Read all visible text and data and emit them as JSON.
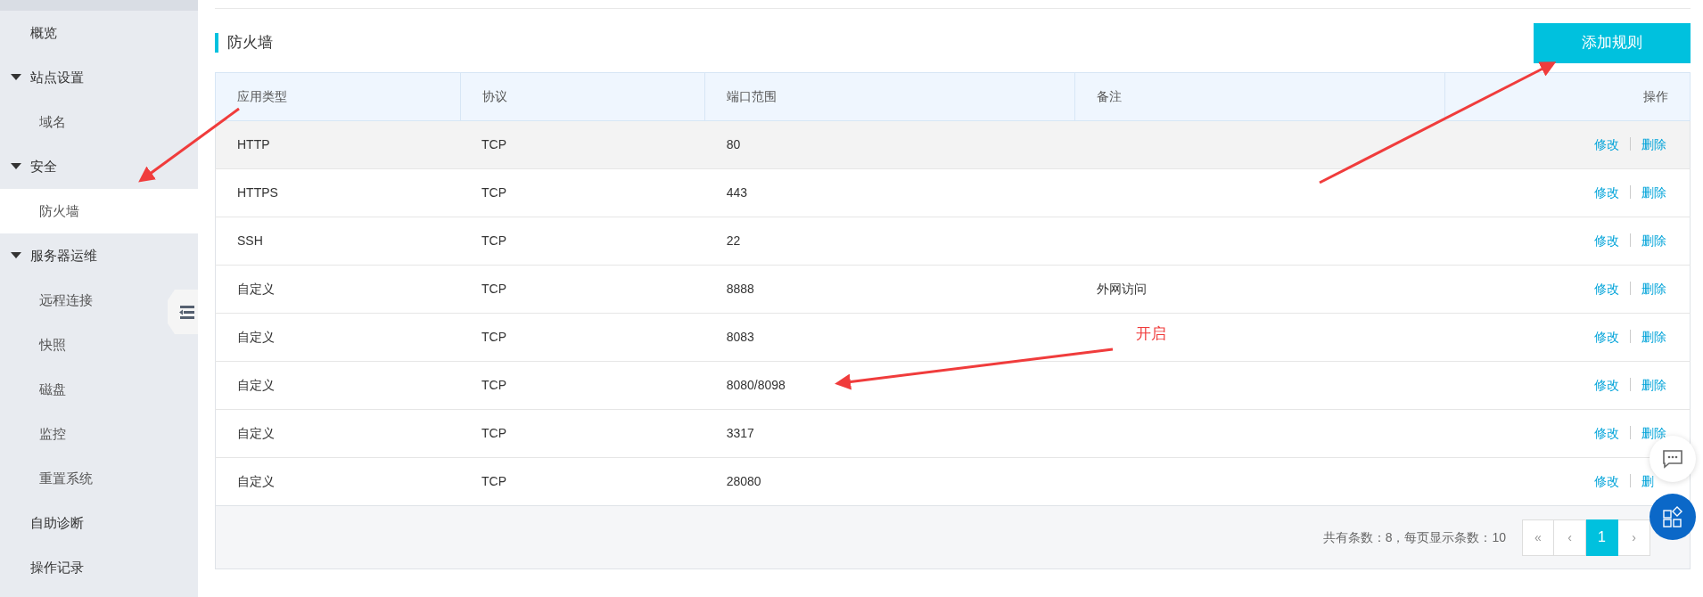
{
  "sidebar": {
    "items": [
      {
        "label": "概览",
        "selected": false
      },
      {
        "label": "站点设置",
        "selected": false,
        "expanded": true,
        "children": [
          {
            "label": "域名",
            "selected": false
          }
        ]
      },
      {
        "label": "安全",
        "selected": false,
        "expanded": true,
        "children": [
          {
            "label": "防火墙",
            "selected": true
          }
        ]
      },
      {
        "label": "服务器运维",
        "selected": false,
        "expanded": true,
        "children": [
          {
            "label": "远程连接",
            "selected": false
          },
          {
            "label": "快照",
            "selected": false
          },
          {
            "label": "磁盘",
            "selected": false
          },
          {
            "label": "监控",
            "selected": false
          },
          {
            "label": "重置系统",
            "selected": false
          }
        ]
      },
      {
        "label": "自助诊断",
        "selected": false
      },
      {
        "label": "操作记录",
        "selected": false
      }
    ]
  },
  "section": {
    "title": "防火墙",
    "add_button": "添加规则"
  },
  "table": {
    "columns": [
      "应用类型",
      "协议",
      "端口范围",
      "备注",
      "操作"
    ],
    "rows": [
      {
        "cells": [
          "HTTP",
          "TCP",
          "80",
          ""
        ],
        "actions": [
          "修改",
          "删除"
        ],
        "hovered": true
      },
      {
        "cells": [
          "HTTPS",
          "TCP",
          "443",
          ""
        ],
        "actions": [
          "修改",
          "删除"
        ],
        "hovered": false
      },
      {
        "cells": [
          "SSH",
          "TCP",
          "22",
          ""
        ],
        "actions": [
          "修改",
          "删除"
        ],
        "hovered": false
      },
      {
        "cells": [
          "自定义",
          "TCP",
          "8888",
          "外网访问"
        ],
        "actions": [
          "修改",
          "删除"
        ],
        "hovered": false
      },
      {
        "cells": [
          "自定义",
          "TCP",
          "8083",
          ""
        ],
        "actions": [
          "修改",
          "删除"
        ],
        "hovered": false
      },
      {
        "cells": [
          "自定义",
          "TCP",
          "8080/8098",
          ""
        ],
        "actions": [
          "修改",
          "删除"
        ],
        "hovered": false
      },
      {
        "cells": [
          "自定义",
          "TCP",
          "3317",
          ""
        ],
        "actions": [
          "修改",
          "删除"
        ],
        "hovered": false
      },
      {
        "cells": [
          "自定义",
          "TCP",
          "28080",
          ""
        ],
        "actions": [
          "修改",
          "删"
        ],
        "hovered": false
      }
    ],
    "summary": "共有条数：8，每页显示条数：10",
    "pagination": [
      {
        "label": "«",
        "selected": false
      },
      {
        "label": "‹",
        "selected": false
      },
      {
        "label": "1",
        "selected": true
      },
      {
        "label": "›",
        "selected": false
      }
    ]
  },
  "annotation": {
    "label": "开启"
  }
}
